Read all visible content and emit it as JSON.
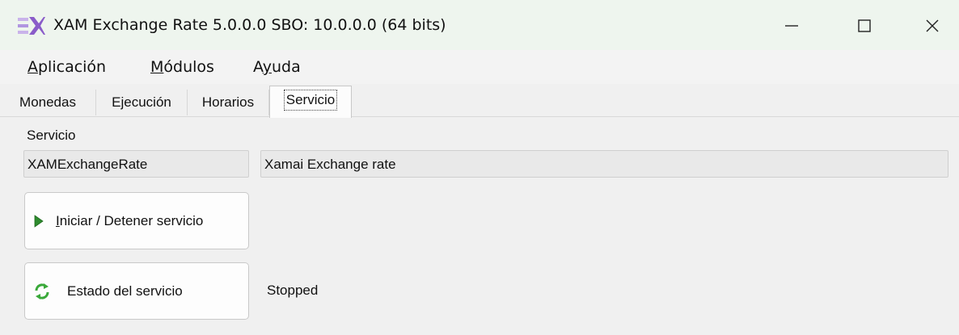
{
  "window": {
    "title": "XAM Exchange Rate 5.0.0.0 SBO: 10.0.0.0 (64 bits)",
    "icon": "xam-logo-icon",
    "controls": [
      "minimize-icon",
      "maximize-icon",
      "close-icon"
    ]
  },
  "menu": {
    "aplicacion_first": "A",
    "aplicacion_rest": "plicación",
    "modulos_first": "M",
    "modulos_rest": "ódulos",
    "ayuda_first": "A",
    "ayuda_mid": "y",
    "ayuda_rest": "uda"
  },
  "tabs": [
    {
      "label": "Monedas"
    },
    {
      "label": "Ejecución"
    },
    {
      "label": "Horarios"
    },
    {
      "label": "Servicio",
      "active": true
    }
  ],
  "servicio": {
    "group_label": "Servicio",
    "service_name": "XAMExchangeRate",
    "service_description": "Xamai Exchange rate",
    "start_stop_first": "I",
    "start_stop_rest": "niciar / Detener servicio",
    "status_button_label": "Estado del servicio",
    "status_value": "Stopped"
  },
  "colors": {
    "titlebar_bg": "#eef5ee",
    "window_bg": "#f0f0f0",
    "play_icon": "#2e8b2e",
    "refresh_icon": "#3aa93a",
    "logo_purple": "#8a5cc9"
  }
}
